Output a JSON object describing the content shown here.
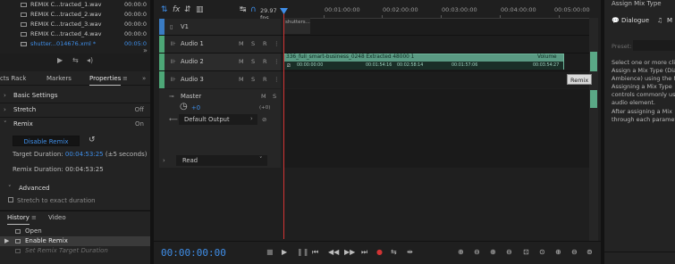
{
  "files": [
    {
      "name": "REMIX C...tracted_1.wav",
      "time": "00:00:0",
      "selected": false
    },
    {
      "name": "REMIX C...tracted_2.wav",
      "time": "00:00:0",
      "selected": false
    },
    {
      "name": "REMIX C...tracted_3.wav",
      "time": "00:00:0",
      "selected": false
    },
    {
      "name": "REMIX C...tracted_4.wav",
      "time": "00:00:0",
      "selected": false
    },
    {
      "name": "shutter...014676.xml *",
      "time": "00:05:0",
      "selected": true
    }
  ],
  "props": {
    "tabs": [
      "cts Rack",
      "Markers",
      "Properties"
    ],
    "sections": {
      "basic": "Basic Settings",
      "stretch": "Stretch",
      "stretch_val": "Off",
      "remix": "Remix",
      "remix_val": "On",
      "advanced": "Advanced",
      "stretch_to_exact": "Stretch to exact duration"
    },
    "disable_remix": "Disable Remix",
    "target_label": "Target Duration:",
    "target_value": "00:04:53:25",
    "target_suffix": "(±5 seconds)",
    "remix_label": "Remix Duration:",
    "remix_value": "00:04:53:25"
  },
  "history": {
    "tabs": [
      "History",
      "Video"
    ],
    "items": [
      {
        "label": "Open",
        "active": false
      },
      {
        "label": "Enable Remix",
        "active": true
      },
      {
        "label": "Set Remix Target Duration",
        "active": false,
        "dim": true
      }
    ]
  },
  "timeline": {
    "fps": "29.97 fps",
    "ruler_labels": [
      "00:01:00:00",
      "00:02:00:00",
      "00:03:00:00",
      "00:04:00:00",
      "00:05:00:00"
    ],
    "tracks": {
      "video": "V1",
      "audio1": "Audio 1",
      "audio2": "Audio 2",
      "audio3": "Audio 3",
      "master": "Master"
    },
    "btn_m": "M",
    "btn_s": "S",
    "btn_r": "R",
    "master_value": "+0",
    "master_zero": "(+0)",
    "default_output": "Default Output",
    "read_mode": "Read",
    "v1_clip": "shutters...",
    "clip_title": "336_full_smart-business_0248 Extracted 48000 1",
    "clip_volume": "Volume",
    "clip_markers": [
      "00:00:00:00",
      "00:01:54:16",
      "00:02:58:14",
      "00:01:57:06",
      "00:03:54:27"
    ],
    "tooltip": "Remix",
    "timecode": "00:00:00:00"
  },
  "essential_sound": {
    "title": "Assign Mix Type",
    "dialogue": "Dialogue",
    "music_initial": "M",
    "preset_label": "Preset:",
    "lines": [
      "Select one or more cli",
      "Assign a Mix Type (Dia",
      "Ambience) using the M",
      "Assigning a Mix Type",
      "controls commonly us",
      "audio element.",
      "After assigning a Mix",
      "through each paramet"
    ]
  },
  "colors": {
    "accent": "#3f8ee8",
    "clip": "#5a9a83",
    "track_green": "#4da777",
    "playhead": "#d23434"
  }
}
